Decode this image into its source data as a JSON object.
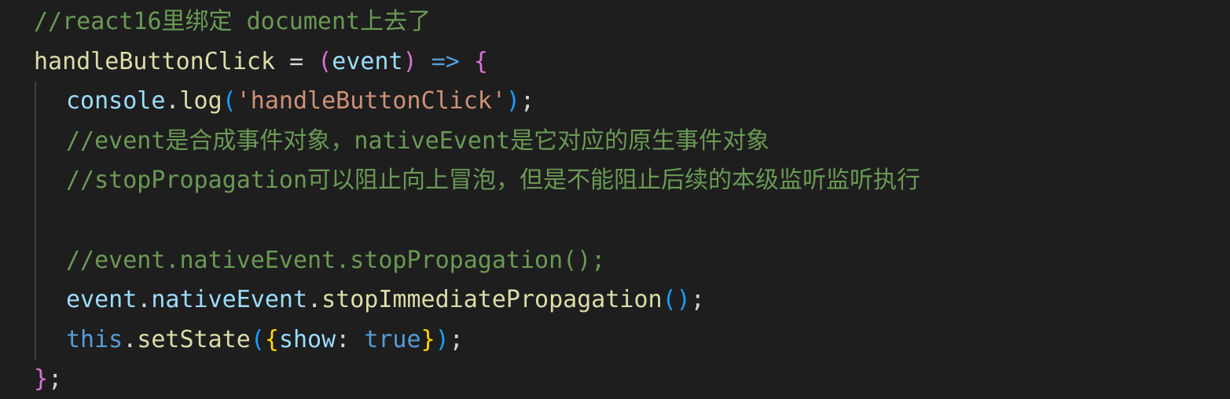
{
  "code": {
    "line1": {
      "comment": "//react16里绑定 document上去了"
    },
    "line2": {
      "name": "handleButtonClick",
      "assign": " = ",
      "paren_open": "(",
      "param": "event",
      "paren_close": ")",
      "arrow": " => ",
      "brace": "{"
    },
    "line3": {
      "obj": "console",
      "dot": ".",
      "method": "log",
      "paren_open": "(",
      "string": "'handleButtonClick'",
      "paren_close": ")",
      "semi": ";"
    },
    "line4": {
      "comment": "//event是合成事件对象，nativeEvent是它对应的原生事件对象"
    },
    "line5": {
      "comment": "//stopPropagation可以阻止向上冒泡，但是不能阻止后续的本级监听监听执行"
    },
    "line7": {
      "comment": "//event.nativeEvent.stopPropagation();"
    },
    "line8": {
      "obj": "event",
      "dot1": ".",
      "prop": "nativeEvent",
      "dot2": ".",
      "method": "stopImmediatePropagation",
      "parens": "()",
      "semi": ";"
    },
    "line9": {
      "kw": "this",
      "dot": ".",
      "method": "setState",
      "paren_open": "(",
      "brace_open": "{",
      "key": "show",
      "colon": ": ",
      "value": "true",
      "brace_close": "}",
      "paren_close": ")",
      "semi": ";"
    },
    "line10": {
      "brace": "}",
      "semi": ";"
    }
  }
}
